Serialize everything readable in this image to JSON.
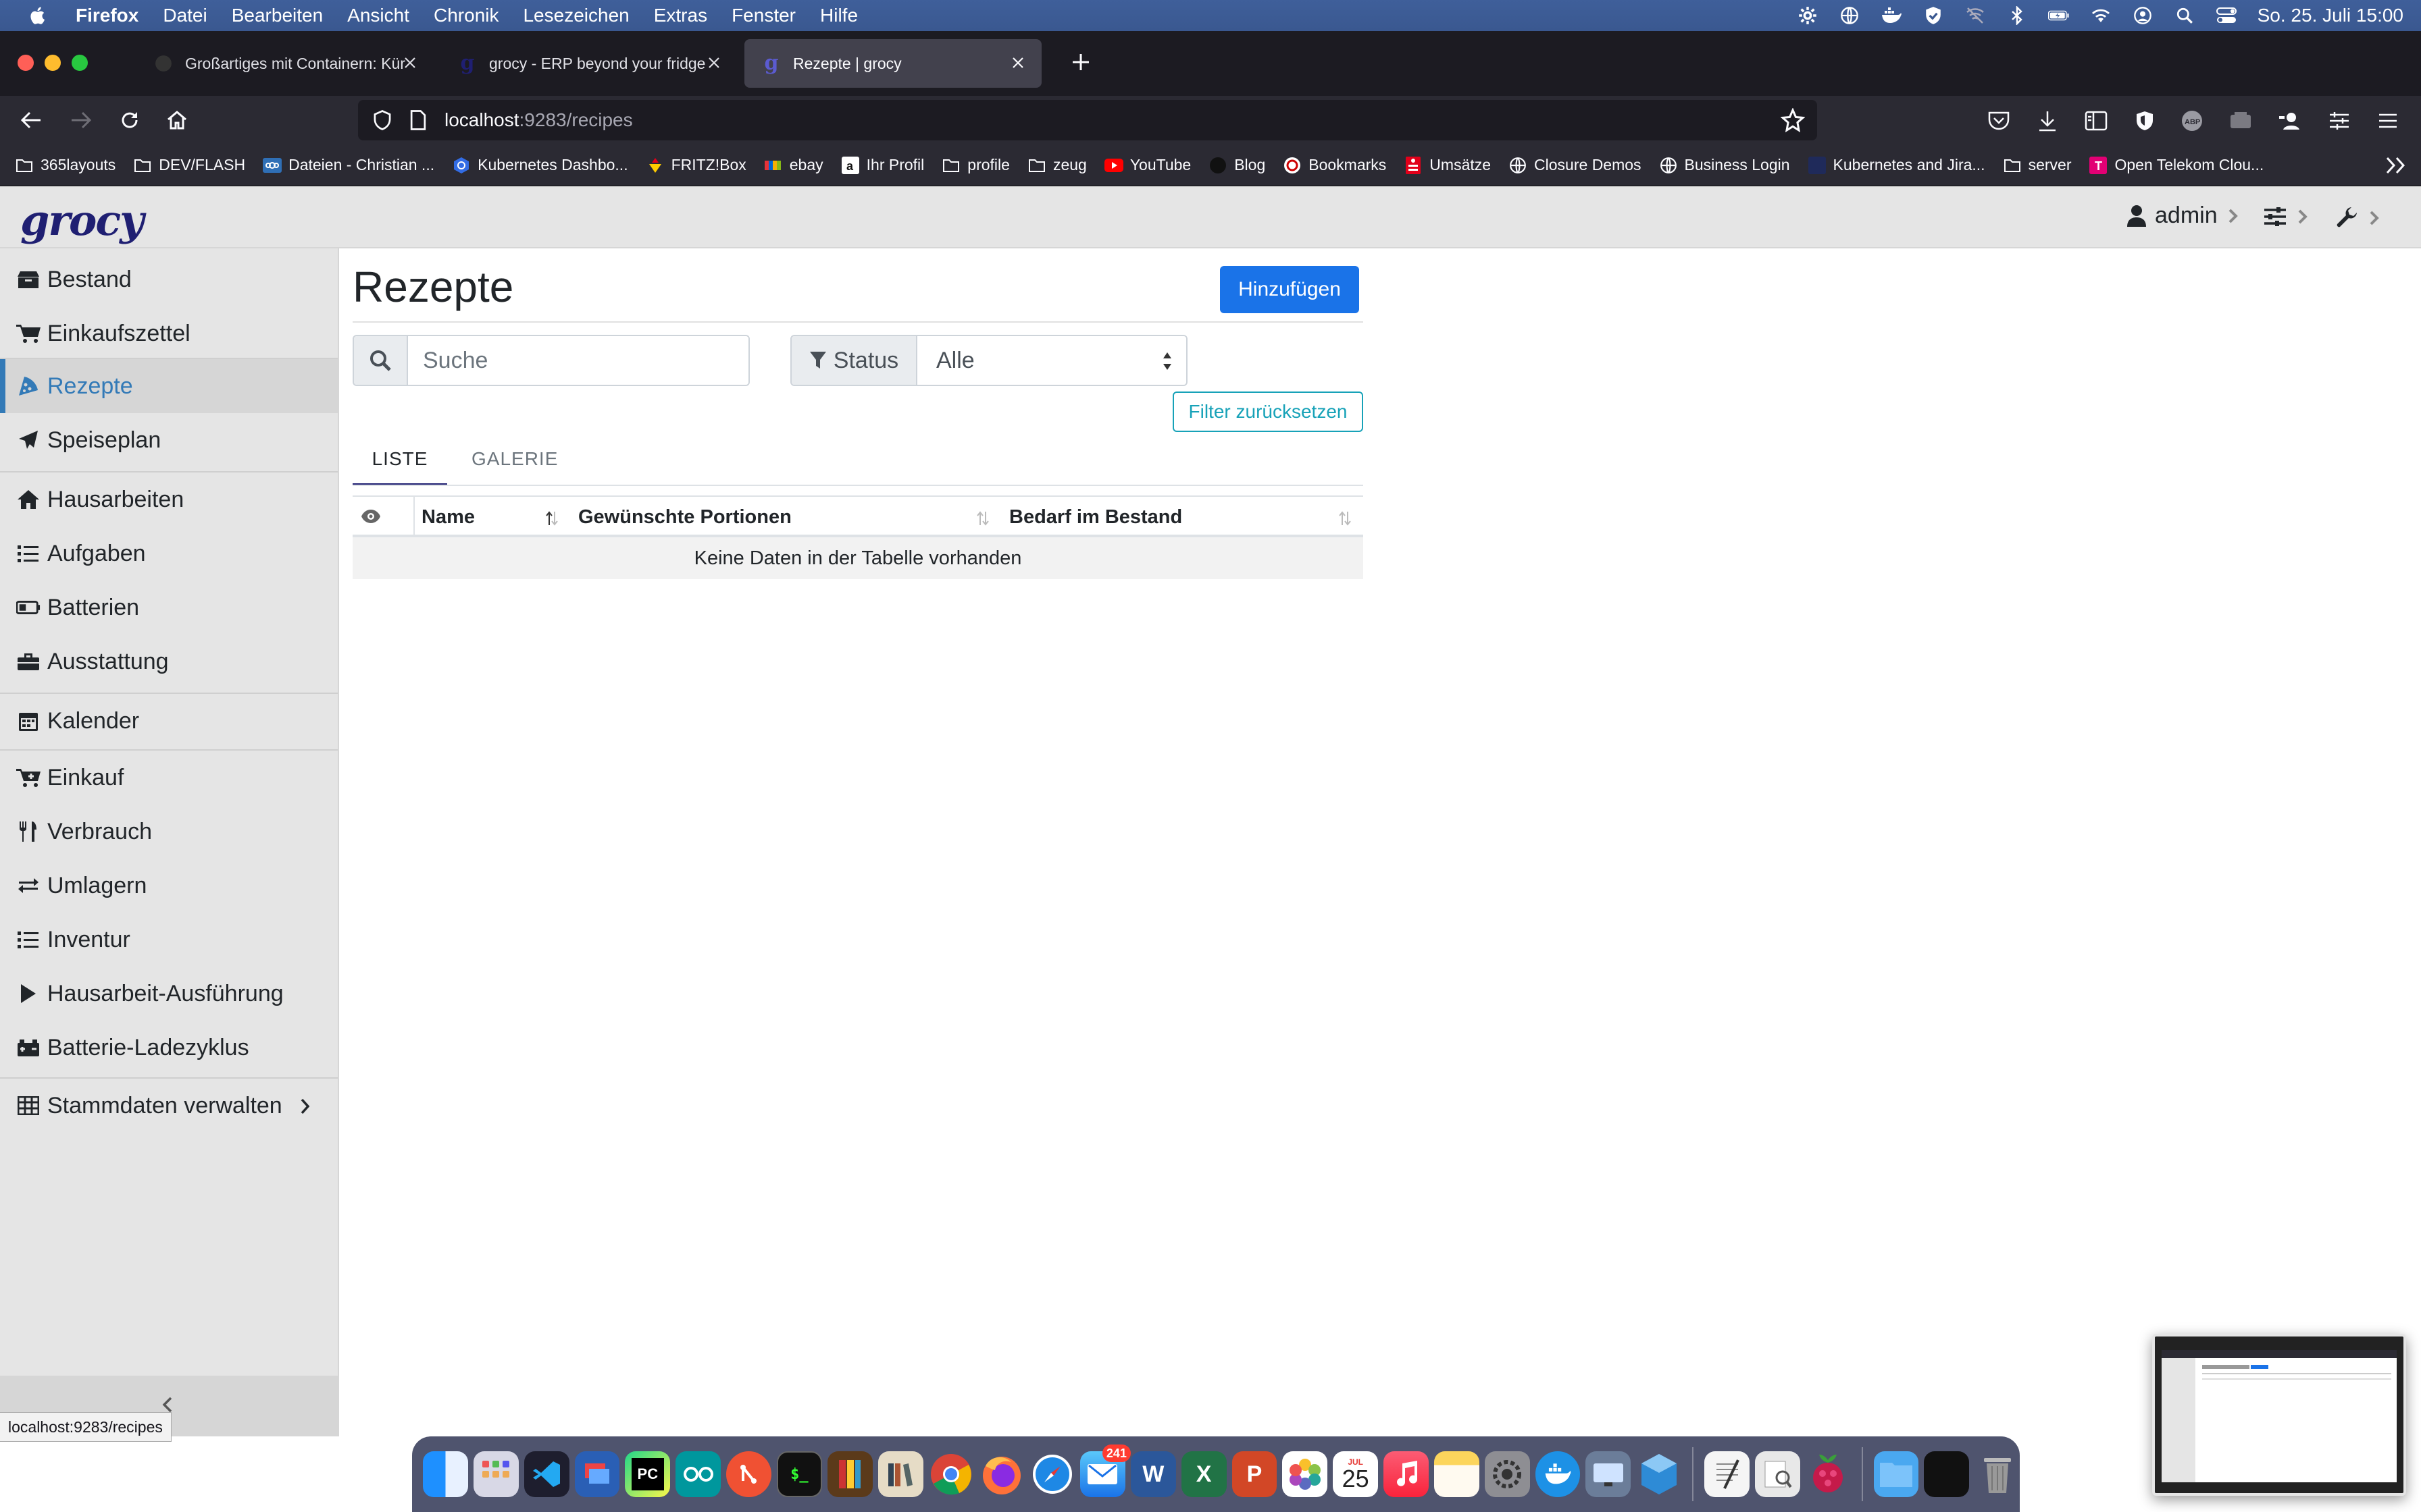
{
  "menubar": {
    "app_name": "Firefox",
    "items": [
      "Datei",
      "Bearbeiten",
      "Ansicht",
      "Chronik",
      "Lesezeichen",
      "Extras",
      "Fenster",
      "Hilfe"
    ],
    "clock": "So. 25. Juli  15:00"
  },
  "browser": {
    "tabs": [
      {
        "label": "Großartiges mit Containern: Kür",
        "active": false
      },
      {
        "label": "grocy - ERP beyond your fridge",
        "active": false
      },
      {
        "label": "Rezepte | grocy",
        "active": true
      }
    ],
    "url_host": "localhost",
    "url_path": ":9283/recipes",
    "bookmarks": [
      "365layouts",
      "DEV/FLASH",
      "Dateien - Christian ...",
      "Kubernetes Dashbo...",
      "FRITZ!Box",
      "ebay",
      "Ihr Profil",
      "profile",
      "zeug",
      "YouTube",
      "Blog",
      "Bookmarks",
      "Umsätze",
      "Closure Demos",
      "Business Login",
      "Kubernetes and Jira...",
      "server",
      "Open Telekom Clou..."
    ],
    "status_url": "localhost:9283/recipes"
  },
  "app": {
    "logo": "grocy",
    "user": "admin"
  },
  "sidebar": {
    "items": [
      {
        "label": "Bestand",
        "icon": "box-icon"
      },
      {
        "label": "Einkaufszettel",
        "icon": "cart-icon"
      },
      {
        "label": "Rezepte",
        "icon": "pizza-icon"
      },
      {
        "label": "Speiseplan",
        "icon": "paper-plane-icon"
      },
      {
        "label": "Hausarbeiten",
        "icon": "home-icon"
      },
      {
        "label": "Aufgaben",
        "icon": "tasks-icon"
      },
      {
        "label": "Batterien",
        "icon": "battery-icon"
      },
      {
        "label": "Ausstattung",
        "icon": "toolbox-icon"
      },
      {
        "label": "Kalender",
        "icon": "calendar-icon"
      },
      {
        "label": "Einkauf",
        "icon": "cart-plus-icon"
      },
      {
        "label": "Verbrauch",
        "icon": "utensils-icon"
      },
      {
        "label": "Umlagern",
        "icon": "exchange-icon"
      },
      {
        "label": "Inventur",
        "icon": "list-icon"
      },
      {
        "label": "Hausarbeit-Ausführung",
        "icon": "play-icon"
      },
      {
        "label": "Batterie-Ladezyklus",
        "icon": "car-battery-icon"
      },
      {
        "label": "Stammdaten verwalten",
        "icon": "table-icon"
      }
    ],
    "active_index": 2
  },
  "main": {
    "title": "Rezepte",
    "add_label": "Hinzufügen",
    "search_placeholder": "Suche",
    "status_label": "Status",
    "status_value": "Alle",
    "reset_label": "Filter zurücksetzen",
    "tabs": [
      "LISTE",
      "GALERIE"
    ],
    "table": {
      "columns": [
        "Name",
        "Gewünschte Portionen",
        "Bedarf im Bestand"
      ],
      "empty_message": "Keine Daten in der Tabelle vorhanden"
    }
  },
  "dock": {
    "mail_badge": "241",
    "calendar_month": "JUL",
    "calendar_day": "25"
  },
  "colors": {
    "accent": "#337ab7",
    "primary_button": "#1a73e8",
    "info": "#17a2b8",
    "logo": "#1f1f72"
  }
}
